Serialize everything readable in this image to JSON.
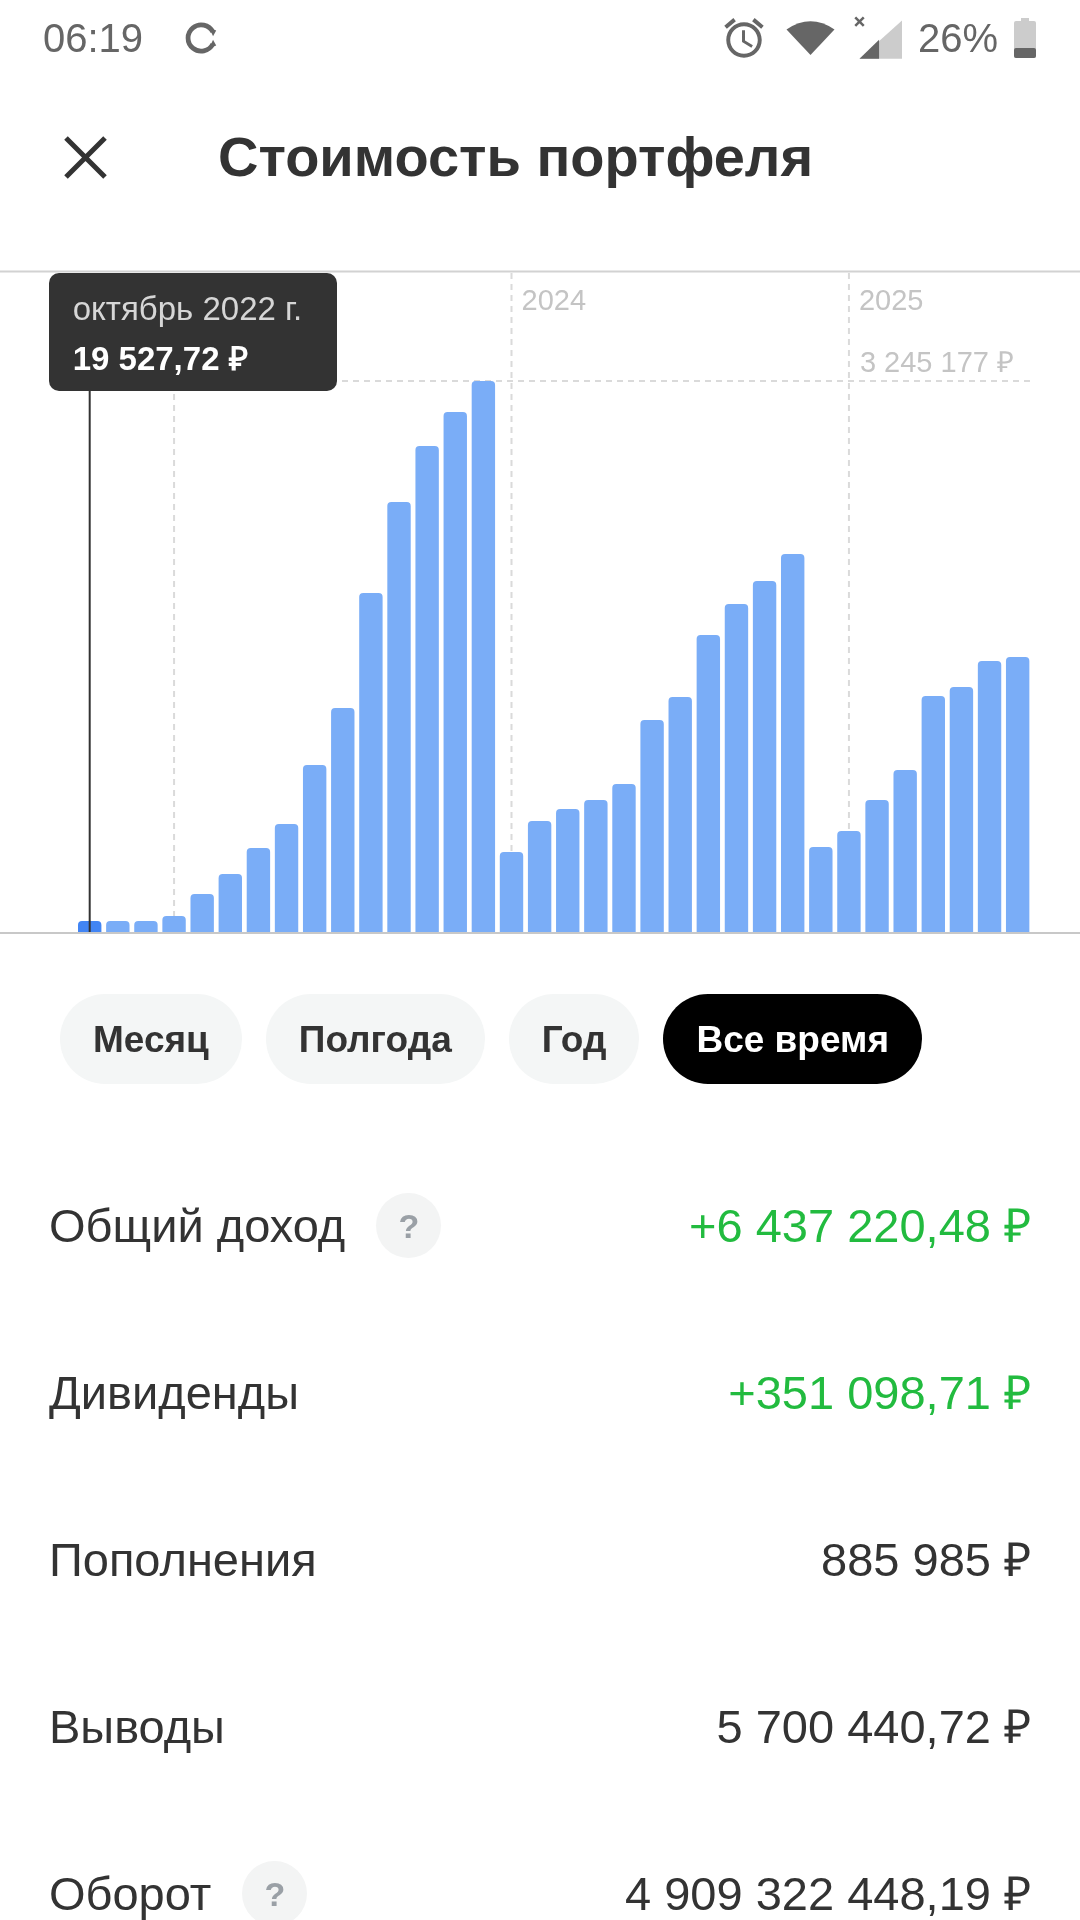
{
  "status_bar": {
    "time": "06:19",
    "battery": "26%"
  },
  "header": {
    "title": "Стоимость портфеля"
  },
  "chart": {
    "year_labels": [
      "2024",
      "2025"
    ],
    "max_label": "3 245 177 ₽",
    "bars": [
      {
        "selected": true
      },
      {
        "selected": false
      },
      {
        "selected": false
      },
      {
        "selected": false
      },
      {
        "selected": false
      },
      {
        "selected": false
      },
      {
        "selected": false
      },
      {
        "selected": false
      },
      {
        "selected": false
      },
      {
        "selected": false
      },
      {
        "selected": false
      },
      {
        "selected": false
      },
      {
        "selected": false
      },
      {
        "selected": false
      },
      {
        "selected": false
      },
      {
        "selected": false
      },
      {
        "selected": false
      },
      {
        "selected": false
      },
      {
        "selected": false
      },
      {
        "selected": false
      },
      {
        "selected": false
      },
      {
        "selected": false
      },
      {
        "selected": false
      },
      {
        "selected": false
      },
      {
        "selected": false
      },
      {
        "selected": false
      },
      {
        "selected": false
      },
      {
        "selected": false
      },
      {
        "selected": false
      },
      {
        "selected": false
      },
      {
        "selected": false
      },
      {
        "selected": false
      },
      {
        "selected": false
      },
      {
        "selected": false
      }
    ],
    "tooltip": {
      "date": "октябрь 2022 г.",
      "value": "19 527,72 ₽"
    }
  },
  "periods": [
    {
      "label": "Месяц",
      "selected": false
    },
    {
      "label": "Полгода",
      "selected": false
    },
    {
      "label": "Год",
      "selected": false
    },
    {
      "label": "Все время",
      "selected": true
    }
  ],
  "rows": [
    {
      "label": "Общий доход",
      "help": "?",
      "value": "+6 437 220,48 ₽",
      "color": "#22bb3f"
    },
    {
      "label": "Дивиденды",
      "value": "+351 098,71 ₽",
      "color": "#22bb3f"
    },
    {
      "label": "Пополнения",
      "value": "885 985 ₽",
      "color": "#333333"
    },
    {
      "label": "Выводы",
      "value": "5 700 440,72 ₽",
      "color": "#333333"
    },
    {
      "label": "Оборот",
      "help": "?",
      "value": "4 909 322 448,19 ₽",
      "color": "#333333"
    }
  ]
}
